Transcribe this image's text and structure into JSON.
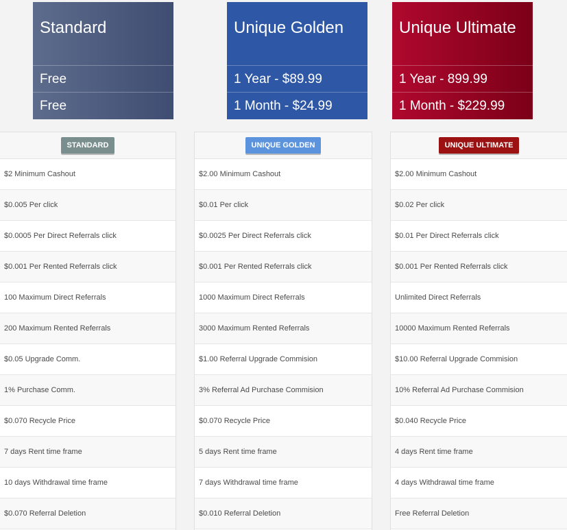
{
  "plans": {
    "standard": {
      "name": "Standard",
      "price1": "Free",
      "price2": "Free",
      "badge": "STANDARD"
    },
    "golden": {
      "name": "Unique Golden",
      "price1": "1 Year - $89.99",
      "price2": "1 Month - $24.99",
      "badge": "UNIQUE GOLDEN"
    },
    "ultimate": {
      "name": "Unique Ultimate",
      "price1": "1 Year - 899.99",
      "price2": "1 Month - $229.99",
      "badge": "UNIQUE ULTIMATE"
    }
  },
  "features": {
    "standard": [
      "$2 Minimum Cashout",
      "$0.005 Per click",
      "$0.0005 Per Direct Referrals click",
      "$0.001 Per Rented Referrals click",
      "100 Maximum Direct Referrals",
      "200 Maximum Rented Referrals",
      "$0.05 Upgrade Comm.",
      "1% Purchase Comm.",
      "$0.070 Recycle Price",
      "7 days Rent time frame",
      "10 days Withdrawal time frame",
      "$0.070 Referral Deletion"
    ],
    "golden": [
      "$2.00 Minimum Cashout",
      "$0.01 Per click",
      "$0.0025 Per Direct Referrals click",
      "$0.001 Per Rented Referrals click",
      "1000 Maximum Direct Referrals",
      "3000 Maximum Rented Referrals",
      "$1.00 Referral Upgrade Commision",
      "3% Referral Ad Purchase Commision",
      "$0.070 Recycle Price",
      "5 days Rent time frame",
      "7 days Withdrawal time frame",
      "$0.010 Referral Deletion"
    ],
    "ultimate": [
      "$2.00 Minimum Cashout",
      "$0.02 Per click",
      "$0.01 Per Direct Referrals click",
      "$0.001 Per Rented Referrals click",
      "Unlimited Direct Referrals",
      "10000 Maximum Rented Referrals",
      "$10.00 Referral Upgrade Commision",
      "10% Referral Ad Purchase Commision",
      "$0.040 Recycle Price",
      "4 days Rent time frame",
      "4 days Withdrawal time frame",
      "Free Referral Deletion"
    ]
  },
  "colors": {
    "standard": "#4a5878",
    "golden": "#2e57a6",
    "ultimate": "#a0052a"
  }
}
